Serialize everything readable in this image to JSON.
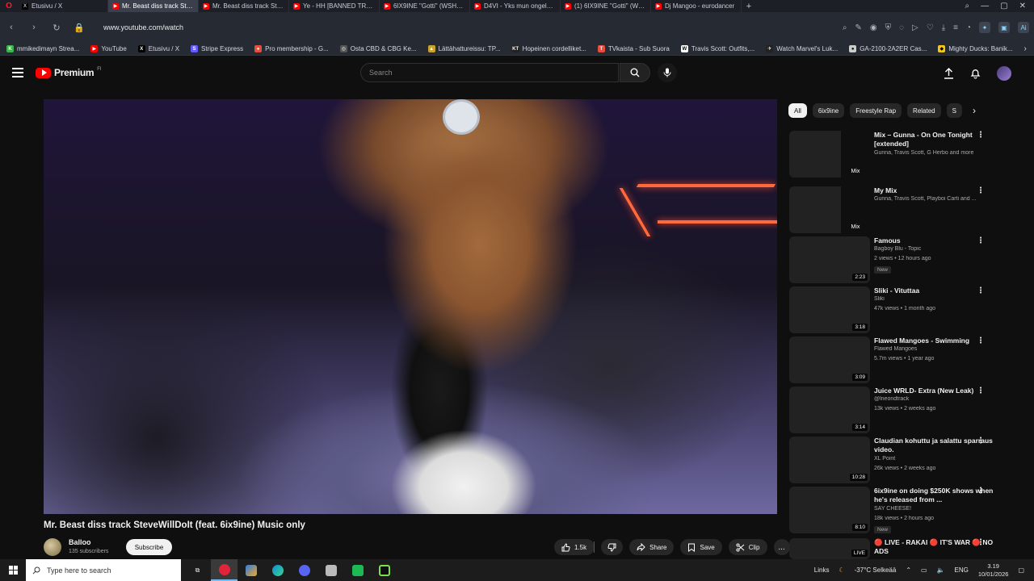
{
  "browser": {
    "tabs": [
      {
        "title": "Etusivu / X",
        "color": "#000000",
        "glyph": "X"
      },
      {
        "title": "Mr. Beast diss track Steve",
        "color": "#ff0000",
        "glyph": "▶",
        "active": true
      },
      {
        "title": "Mr. Beast diss track Steve",
        "color": "#ff0000",
        "glyph": "▶"
      },
      {
        "title": "Ye - HH [BANNED TRACK]",
        "color": "#ff0000",
        "glyph": "▶"
      },
      {
        "title": "6IX9INE \"Gotti\" (WSHH E",
        "color": "#ff0000",
        "glyph": "▶"
      },
      {
        "title": "D4VI - Yks mun ongelmist",
        "color": "#ff0000",
        "glyph": "▶"
      },
      {
        "title": "(1) 6IX9INE \"Gotti\" (WSH",
        "color": "#ff0000",
        "glyph": "▶"
      },
      {
        "title": "Dj Mangoo - eurodancer",
        "color": "#ff0000",
        "glyph": "▶"
      }
    ],
    "new_tab": "+",
    "url": "www.youtube.com/watch",
    "bookmarks": [
      {
        "label": "mmikedimayn Strea...",
        "color": "#3ab54a",
        "glyph": "K"
      },
      {
        "label": "YouTube",
        "color": "#ff0000",
        "glyph": "▶"
      },
      {
        "label": "Etusivu / X",
        "color": "#000000",
        "glyph": "X"
      },
      {
        "label": "Stripe Express",
        "color": "#635bff",
        "glyph": "S"
      },
      {
        "label": "Pro membership - G...",
        "color": "#e74c3c",
        "glyph": "●"
      },
      {
        "label": "Osta CBD & CBG Ke...",
        "color": "#555555",
        "glyph": "◎"
      },
      {
        "label": "Lättähattureissu: TP...",
        "color": "#c9a227",
        "glyph": "▲"
      },
      {
        "label": "Hopeinen cordelliket...",
        "color": "#222222",
        "glyph": "KT"
      },
      {
        "label": "TVkaista - Sub Suora",
        "color": "#e74c3c",
        "glyph": "T"
      },
      {
        "label": "Travis Scott: Outfits,...",
        "color": "#ffffff",
        "glyph": "W"
      },
      {
        "label": "Watch Marvel's Luk...",
        "color": "#222222",
        "glyph": "✈"
      },
      {
        "label": "GA-2100-2A2ER Cas...",
        "color": "#cccccc",
        "glyph": "●"
      },
      {
        "label": "Mighty Ducks: Banik...",
        "color": "#f5c518",
        "glyph": "◆"
      }
    ]
  },
  "youtube": {
    "logo_text": "Premium",
    "region": "FI",
    "search_placeholder": "Search",
    "video": {
      "title": "Mr. Beast diss track SteveWillDoIt (feat. 6ix9ine) Music only",
      "channel": "Balloo",
      "subscribers": "135 subscribers",
      "subscribe_label": "Subscribe",
      "likes": "1.5k",
      "share_label": "Share",
      "save_label": "Save",
      "clip_label": "Clip",
      "more": "..."
    },
    "chips": [
      "All",
      "6ix9ine",
      "Freestyle Rap",
      "Related",
      "S"
    ],
    "recommendations": [
      {
        "title": "Mix – Gunna - On One Tonight [extended]",
        "line1": "Gunna, Travis Scott, G Herbo and more",
        "line2": "",
        "overlay": "Mix",
        "badge": "",
        "thumb": "th1"
      },
      {
        "title": "My Mix",
        "line1": "Gunna, Travis Scott, Playboi Carti and ...",
        "line2": "",
        "overlay": "Mix",
        "badge": "",
        "thumb": "th2"
      },
      {
        "title": "Famous",
        "line1": "Bagboy Blu - Topic",
        "line2": "2 views • 12 hours ago",
        "overlay": "2:23",
        "badge": "New",
        "thumb": "th3"
      },
      {
        "title": "Sliki - Vituttaa",
        "line1": "Sliki",
        "line2": "47k views • 1 month ago",
        "overlay": "3:18",
        "badge": "",
        "thumb": "th4"
      },
      {
        "title": "Flawed Mangoes - Swimming",
        "line1": "Flawed Mangoes",
        "line2": "5.7m views • 1 year ago",
        "overlay": "3:09",
        "badge": "",
        "thumb": "th5"
      },
      {
        "title": "Juice WRLD- Extra (New Leak)",
        "line1": "@lneondtrack",
        "line2": "13k views • 2 weeks ago",
        "overlay": "3:14",
        "badge": "",
        "thumb": "th6"
      },
      {
        "title": "Claudian kohuttu ja salattu sparraus video.",
        "line1": "XL Point",
        "line2": "26k views • 2 weeks ago",
        "overlay": "10:28",
        "badge": "",
        "thumb": "th7"
      },
      {
        "title": "6ix9ine on doing $250K shows when he's released from ...",
        "line1": "SAY CHEESE!",
        "line2": "18k views • 2 hours ago",
        "overlay": "8:10",
        "badge": "New",
        "thumb": "th8"
      },
      {
        "title": "🔴 LIVE - RAKAI 🔴 IT'S WAR 🔴 NO ADS",
        "line1": "",
        "line2": "",
        "overlay": "LIVE",
        "badge": "",
        "thumb": "th9"
      }
    ]
  },
  "taskbar": {
    "search_placeholder": "Type here to search",
    "links": "Links",
    "weather": "-37°C Selkeää",
    "lang": "ENG",
    "time": "3.19",
    "date": "10/01/2026"
  }
}
